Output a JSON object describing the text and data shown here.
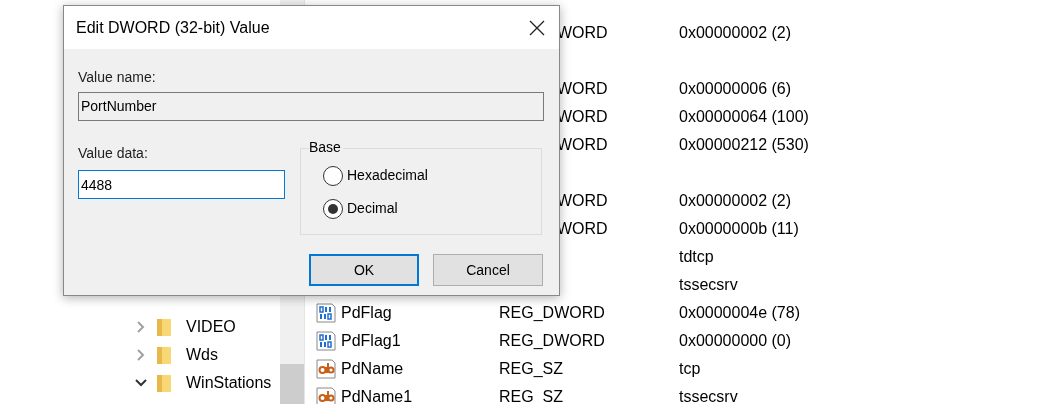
{
  "tree": {
    "items": [
      {
        "label": "VIDEO",
        "expanded": false
      },
      {
        "label": "Wds",
        "expanded": false
      },
      {
        "label": "WinStations",
        "expanded": true
      }
    ]
  },
  "values": [
    {
      "kind": "covered",
      "type": "WORD",
      "data": "0x00000002 (2)"
    },
    {
      "kind": "covered"
    },
    {
      "kind": "covered",
      "type": "WORD",
      "data": "0x00000006 (6)"
    },
    {
      "kind": "covered",
      "type": "WORD",
      "data": "0x00000064 (100)"
    },
    {
      "kind": "covered",
      "type": "WORD",
      "data": "0x00000212 (530)"
    },
    {
      "kind": "covered"
    },
    {
      "kind": "covered",
      "type": "WORD",
      "data": "0x00000002 (2)"
    },
    {
      "kind": "covered",
      "type": "WORD",
      "data": "0x0000000b (11)"
    },
    {
      "kind": "covered",
      "data": "tdtcp"
    },
    {
      "kind": "covered",
      "data": "tssecsrv"
    },
    {
      "kind": "dword",
      "name": "PdFlag",
      "type": "REG_DWORD",
      "data": "0x0000004e (78)"
    },
    {
      "kind": "dword",
      "name": "PdFlag1",
      "type": "REG_DWORD",
      "data": "0x00000000 (0)"
    },
    {
      "kind": "string",
      "name": "PdName",
      "type": "REG_SZ",
      "data": "tcp"
    },
    {
      "kind": "string",
      "name": "PdName1",
      "type": "REG_SZ",
      "data": "tssecsrv"
    }
  ],
  "dialog": {
    "title": "Edit DWORD (32-bit) Value",
    "value_name_label": "Value name:",
    "value_name": "PortNumber",
    "value_data_label": "Value data:",
    "value_data": "4488",
    "base": {
      "label": "Base",
      "options": [
        {
          "label": "Hexadecimal",
          "selected": false
        },
        {
          "label": "Decimal",
          "selected": true
        }
      ]
    },
    "buttons": [
      {
        "label": "OK",
        "default": true
      },
      {
        "label": "Cancel",
        "default": false
      }
    ]
  }
}
